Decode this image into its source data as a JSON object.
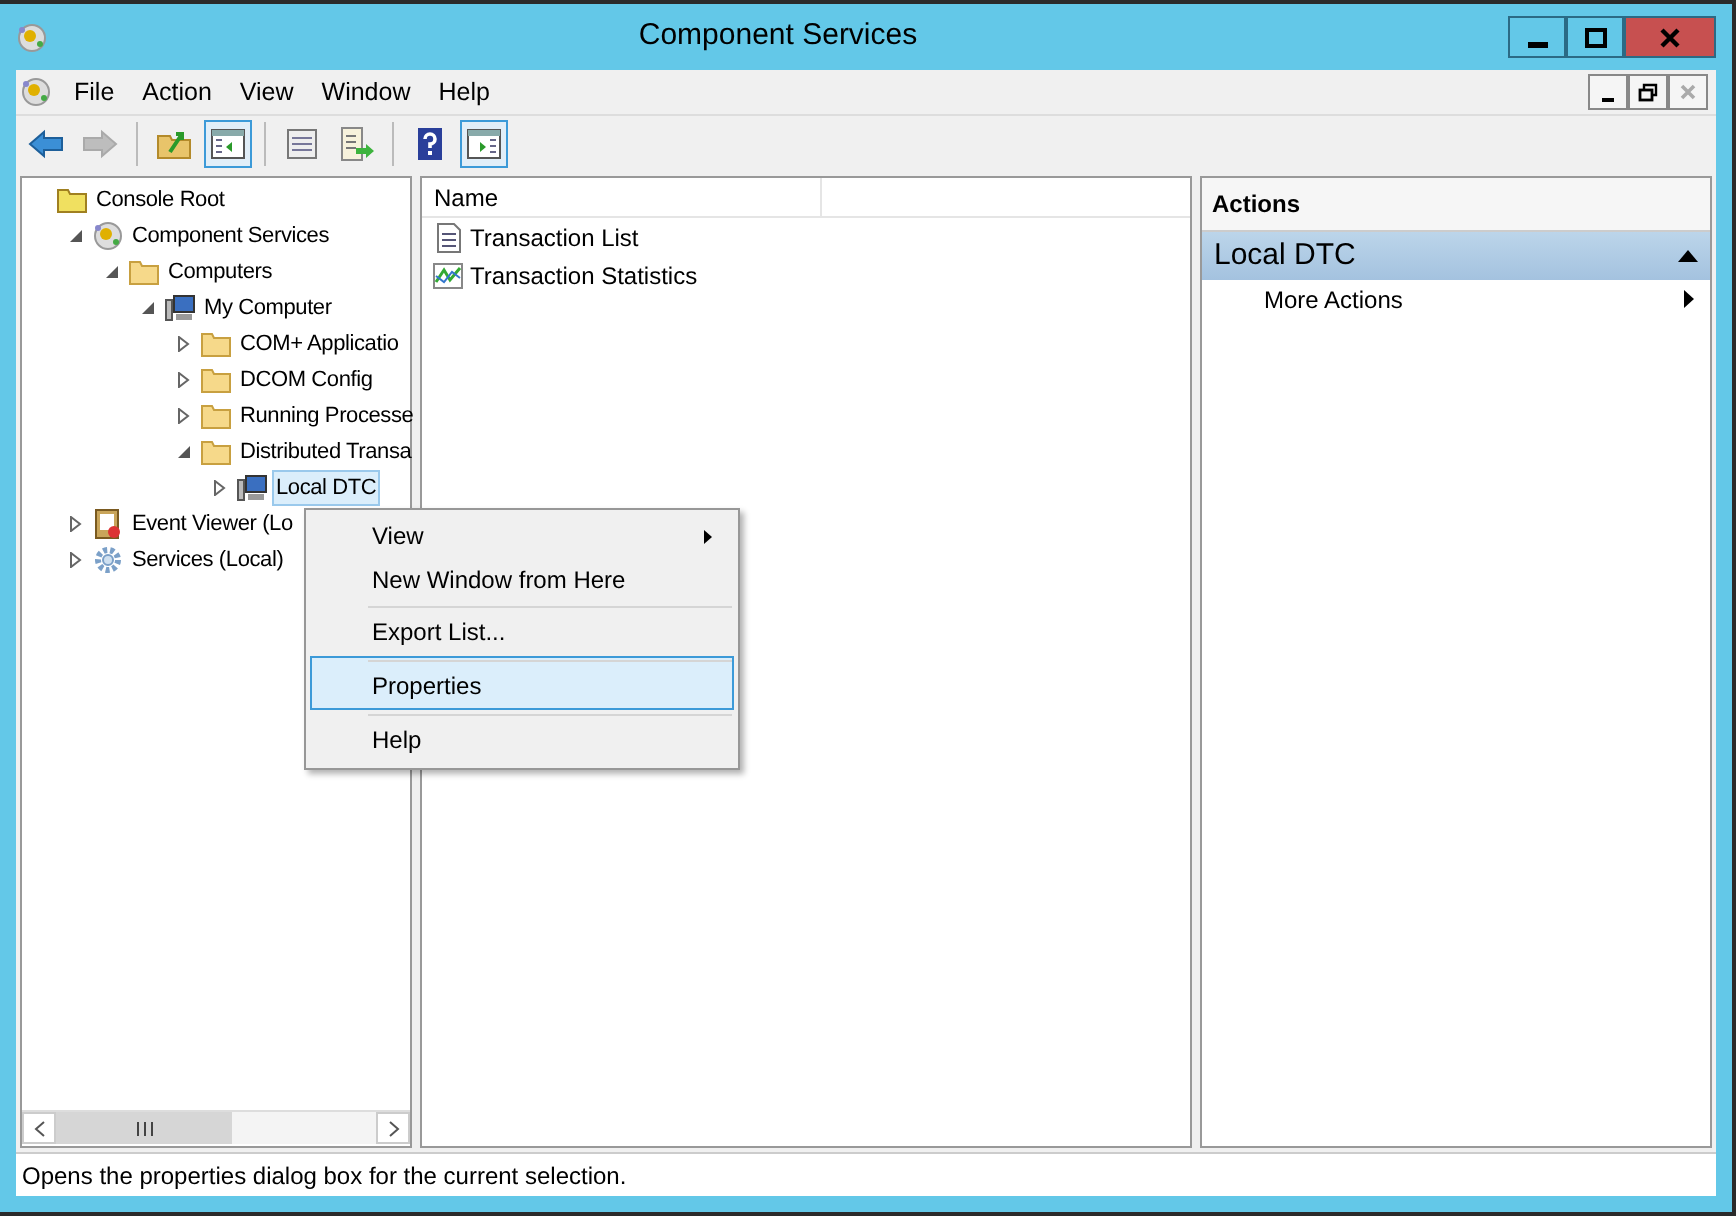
{
  "window": {
    "title": "Component Services"
  },
  "menu": [
    "File",
    "Action",
    "View",
    "Window",
    "Help"
  ],
  "toolbar": [
    {
      "kind": "back",
      "disabled": false,
      "pressed": false
    },
    {
      "kind": "forward",
      "disabled": true,
      "pressed": false
    },
    {
      "kind": "up",
      "disabled": false,
      "pressed": false
    },
    {
      "kind": "tree-toggle",
      "disabled": false,
      "pressed": true
    },
    {
      "kind": "properties",
      "disabled": false,
      "pressed": false
    },
    {
      "kind": "export",
      "disabled": false,
      "pressed": false
    },
    {
      "kind": "help",
      "disabled": false,
      "pressed": false
    },
    {
      "kind": "action-toggle",
      "disabled": false,
      "pressed": true
    }
  ],
  "tree": [
    {
      "label": "Console Root",
      "kind": "root",
      "selected": false,
      "children": [
        {
          "label": "Component Services",
          "kind": "app",
          "expanded": true,
          "selected": false,
          "children": [
            {
              "label": "Computers",
              "kind": "folder",
              "expanded": true,
              "selected": false,
              "children": [
                {
                  "label": "My Computer",
                  "kind": "computer",
                  "expanded": true,
                  "selected": false,
                  "children": [
                    {
                      "label": "COM+ Applicatio",
                      "kind": "folder",
                      "expanded": false,
                      "selected": false
                    },
                    {
                      "label": "DCOM Config",
                      "kind": "folder",
                      "expanded": false,
                      "selected": false
                    },
                    {
                      "label": "Running Processe",
                      "kind": "folder",
                      "expanded": false,
                      "selected": false
                    },
                    {
                      "label": "Distributed Transa",
                      "kind": "folder",
                      "expanded": true,
                      "selected": false,
                      "children": [
                        {
                          "label": "Local DTC",
                          "kind": "computer",
                          "expanded": false,
                          "selected": true
                        }
                      ]
                    }
                  ]
                }
              ]
            }
          ]
        },
        {
          "label": "Event Viewer (Lo",
          "kind": "log",
          "expanded": false,
          "selected": false
        },
        {
          "label": "Services (Local)",
          "kind": "gear",
          "expanded": false,
          "selected": false
        }
      ]
    }
  ],
  "list": {
    "columns": [
      "Name"
    ],
    "rows": [
      {
        "name": "Transaction List",
        "kind": "list"
      },
      {
        "name": "Transaction Statistics",
        "kind": "chart"
      }
    ]
  },
  "actions": {
    "title": "Actions",
    "section": {
      "title": "Local DTC",
      "expanded": true
    },
    "items": [
      {
        "label": "More Actions",
        "submenu": true
      }
    ]
  },
  "context_menu": [
    {
      "label": "View",
      "submenu": true,
      "separator_before": false,
      "selected": false
    },
    {
      "label": "New Window from Here",
      "submenu": false,
      "separator_before": false,
      "selected": false
    },
    {
      "label": "Export List...",
      "submenu": false,
      "separator_before": true,
      "selected": false
    },
    {
      "label": "Properties",
      "submenu": false,
      "separator_before": true,
      "selected": true
    },
    {
      "label": "Help",
      "submenu": false,
      "separator_before": true,
      "selected": false
    }
  ],
  "status_bar": "Opens the properties dialog box for the current selection."
}
